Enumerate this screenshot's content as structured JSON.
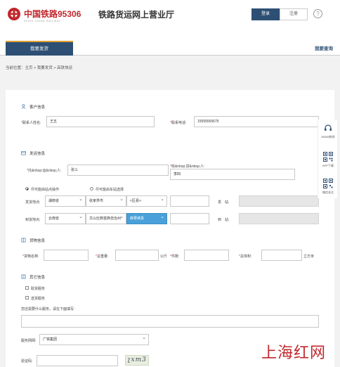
{
  "header": {
    "logo_cn": "中国铁路95306",
    "logo_en": "95306 CHINA RAILWAY",
    "site_title": "铁路货运网上营业厅",
    "login_label": "登录",
    "register_label": "注册",
    "help_label": "?"
  },
  "nav": {
    "tab_label": "我要发货",
    "right_link": "我要查询"
  },
  "breadcrumb": "当前位置：主页 > 我要发货 > 高铁快运",
  "customer": {
    "title": "客户信息",
    "contact_label": "联系人姓名:",
    "contact_value": "王五",
    "phone_label": "联系电话:",
    "phone_value": "15555555675"
  },
  "shipping": {
    "title": "发运信息",
    "sender_label": "托&nbsp;运&nbsp;人:",
    "sender_value": "张三",
    "receiver_label": "收&nbsp;货&nbsp;人:",
    "receiver_value": "李四",
    "radio_station": "尽可能由站点操作",
    "radio_door": "尽可能由车站选择",
    "origin_label": "发货地点:",
    "origin_province": "湖南省",
    "origin_city": "张家界市",
    "origin_district": "<区县>",
    "origin_station_label": "发　站:",
    "dest_label": "到货地点:",
    "dest_province": "云南省",
    "dest_city": "文山壮族苗族自治州",
    "dest_district": "麻栗坡县",
    "dest_station_label": "到　站:"
  },
  "goods": {
    "title": "货物信息",
    "name_label": "货物名称:",
    "weight_label": "总重量:",
    "weight_unit": "公斤",
    "count_label": "件数:",
    "volume_label": "总体积:",
    "volume_unit": "立方米"
  },
  "other": {
    "title": "其它信息",
    "option1": "取货服务",
    "option2": "送货服务",
    "extra_label": "您还需要什么服务，请在下面填写:",
    "network_label": "服务网网:",
    "network_value": "广铁集团",
    "captcha_label": "验证码:",
    "captcha_text": "ʅxm3"
  },
  "side_tools": [
    {
      "icon": "headset-icon",
      "label": "95306热线"
    },
    {
      "icon": "qr-icon",
      "label": "APP下载"
    },
    {
      "icon": "qr-icon",
      "label": "微信关注"
    }
  ],
  "watermark": "上海红网",
  "colors": {
    "brand_red": "#c0272d",
    "nav_blue": "#2d4f73",
    "active_select": "#4aa0d8"
  }
}
